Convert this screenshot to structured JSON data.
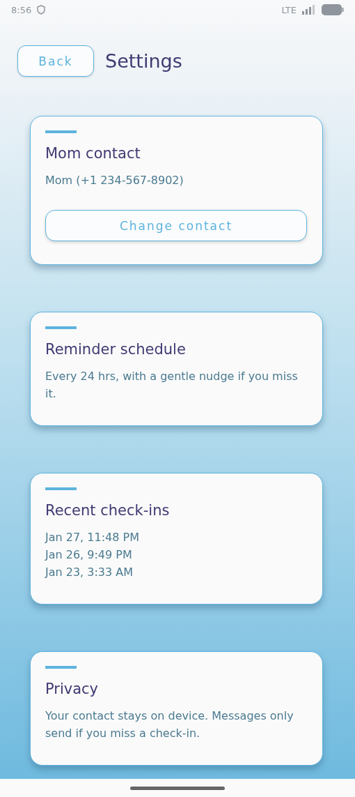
{
  "status_bar": {
    "time": "8:56",
    "network": "LTE"
  },
  "header": {
    "back_button": "Back",
    "title": "Settings"
  },
  "cards": [
    {
      "kind": "contact",
      "title": "Mom contact",
      "body": "Mom (+1 234-567-8902)",
      "button": "Change contact"
    },
    {
      "kind": "text",
      "title": "Reminder schedule",
      "body": "Every 24 hrs, with a gentle nudge if you miss it."
    },
    {
      "kind": "list",
      "title": "Recent check-ins",
      "items": [
        "Jan 27, 11:48 PM",
        "Jan 26, 9:49 PM",
        "Jan 23, 3:33 AM"
      ]
    },
    {
      "kind": "text",
      "title": "Privacy",
      "body": "Your contact stays on device. Messages only send if you miss a check-in."
    }
  ]
}
